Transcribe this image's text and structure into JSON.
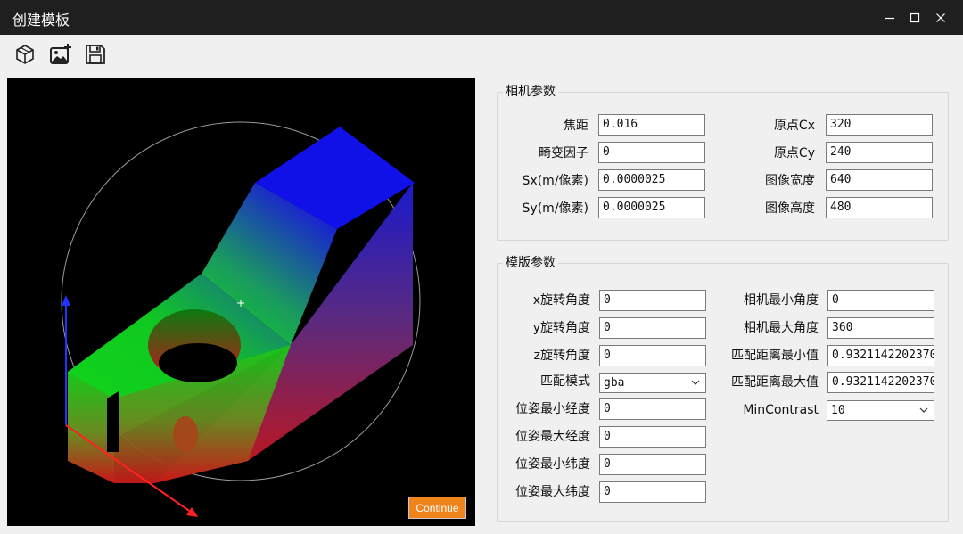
{
  "window": {
    "title": "创建模板",
    "minimize_icon": "minimize-icon",
    "maximize_icon": "maximize-icon",
    "close_icon": "close-icon"
  },
  "toolbar": {
    "icons": [
      "cube-3d-icon",
      "add-image-icon",
      "save-icon"
    ]
  },
  "viewport": {
    "background": "#000000",
    "continue_label": "Continue",
    "continue_color": "#f0841c"
  },
  "camera_params": {
    "title": "相机参数",
    "focal_label": "焦距",
    "focal_value": "0.016",
    "distortion_label": "畸变因子",
    "distortion_value": "0",
    "sx_label": "Sx(m/像素)",
    "sx_value": "0.0000025",
    "sy_label": "Sy(m/像素)",
    "sy_value": "0.0000025",
    "cx_label": "原点Cx",
    "cx_value": "320",
    "cy_label": "原点Cy",
    "cy_value": "240",
    "width_label": "图像宽度",
    "width_value": "640",
    "height_label": "图像高度",
    "height_value": "480"
  },
  "template_params": {
    "title": "模版参数",
    "xrot_label": "x旋转角度",
    "xrot_value": "0",
    "yrot_label": "y旋转角度",
    "yrot_value": "0",
    "zrot_label": "z旋转角度",
    "zrot_value": "0",
    "match_mode_label": "匹配模式",
    "match_mode_value": "gba",
    "pose_min_lon_label": "位姿最小经度",
    "pose_min_lon_value": "0",
    "pose_max_lon_label": "位姿最大经度",
    "pose_max_lon_value": "0",
    "pose_min_lat_label": "位姿最小纬度",
    "pose_min_lat_value": "0",
    "pose_max_lat_label": "位姿最大纬度",
    "pose_max_lat_value": "0",
    "cam_min_angle_label": "相机最小角度",
    "cam_min_angle_value": "0",
    "cam_max_angle_label": "相机最大角度",
    "cam_max_angle_value": "360",
    "match_min_dist_label": "匹配距离最小值",
    "match_min_dist_value": "0.9321142202370",
    "match_max_dist_label": "匹配距离最大值",
    "match_max_dist_value": "0.9321142202370",
    "min_contrast_label": "MinContrast",
    "min_contrast_value": "10"
  }
}
